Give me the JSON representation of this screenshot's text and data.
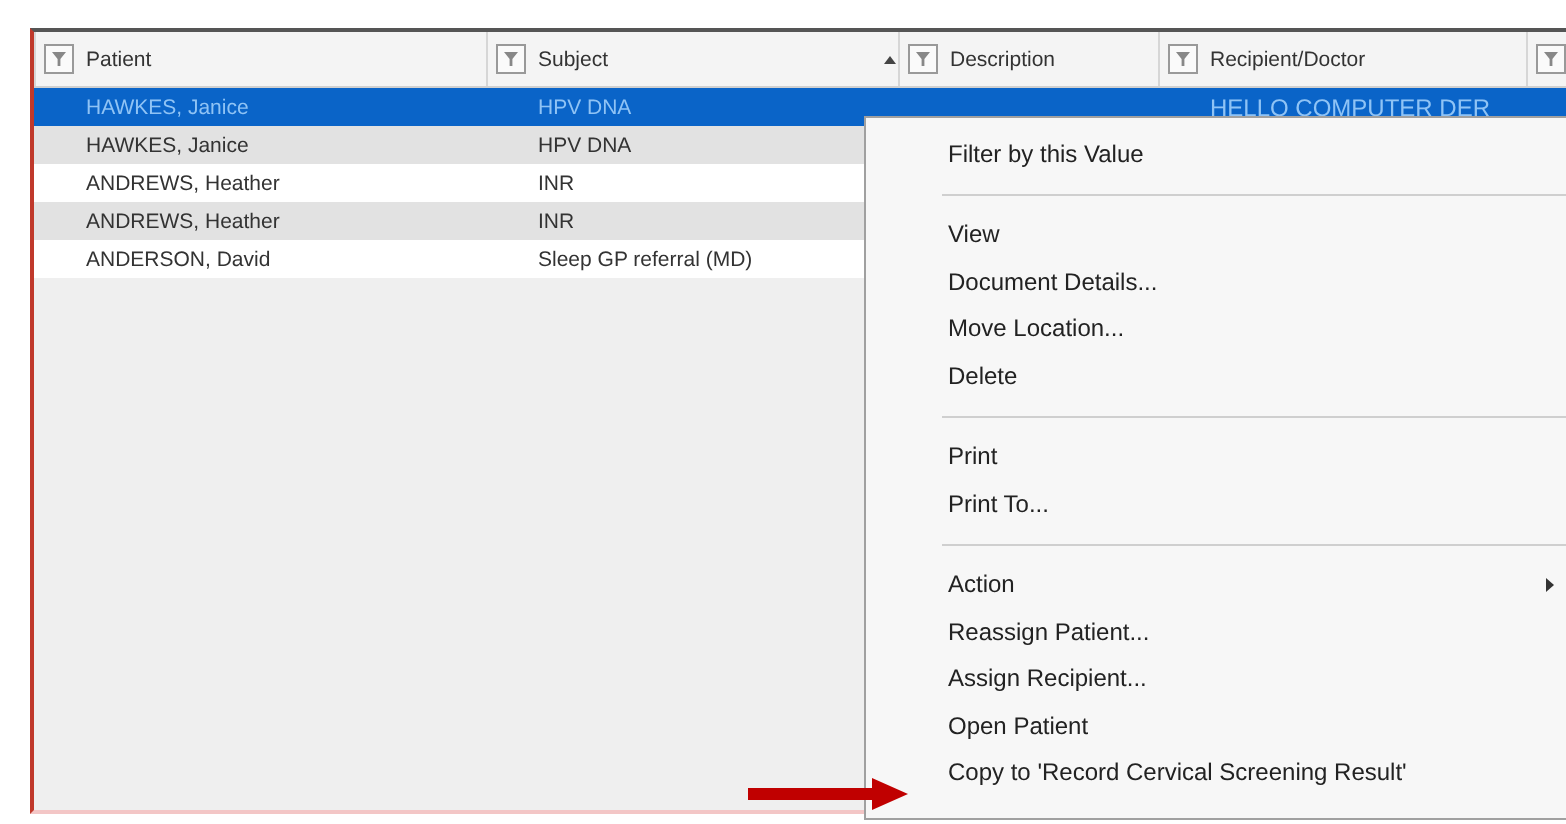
{
  "table": {
    "columns": [
      {
        "label": "Patient",
        "sorted": false
      },
      {
        "label": "Subject",
        "sorted": true
      },
      {
        "label": "Description",
        "sorted": false
      },
      {
        "label": "Recipient/Doctor",
        "sorted": false
      }
    ],
    "rows": [
      {
        "patient": "HAWKES, Janice",
        "subject": "HPV DNA",
        "recipient": "HELLO COMPUTER DER",
        "selected": true
      },
      {
        "patient": "HAWKES, Janice",
        "subject": "HPV DNA",
        "selected": false
      },
      {
        "patient": "ANDREWS, Heather",
        "subject": "INR",
        "selected": false
      },
      {
        "patient": "ANDREWS, Heather",
        "subject": "INR",
        "selected": false
      },
      {
        "patient": "ANDERSON, David",
        "subject": "Sleep GP referral (MD)",
        "selected": false
      }
    ]
  },
  "context_menu": {
    "items": [
      {
        "kind": "item",
        "label": "Filter by this Value"
      },
      {
        "kind": "separator"
      },
      {
        "kind": "item",
        "label": "View"
      },
      {
        "kind": "item",
        "label": "Document Details..."
      },
      {
        "kind": "item",
        "label": "Move Location..."
      },
      {
        "kind": "item",
        "label": "Delete"
      },
      {
        "kind": "separator"
      },
      {
        "kind": "item",
        "label": "Print"
      },
      {
        "kind": "item",
        "label": "Print To..."
      },
      {
        "kind": "separator"
      },
      {
        "kind": "item",
        "label": "Action",
        "submenu": true
      },
      {
        "kind": "item",
        "label": "Reassign Patient..."
      },
      {
        "kind": "item",
        "label": "Assign Recipient..."
      },
      {
        "kind": "item",
        "label": "Open Patient"
      },
      {
        "kind": "item",
        "label": "Copy to 'Record Cervical Screening Result'"
      }
    ]
  }
}
